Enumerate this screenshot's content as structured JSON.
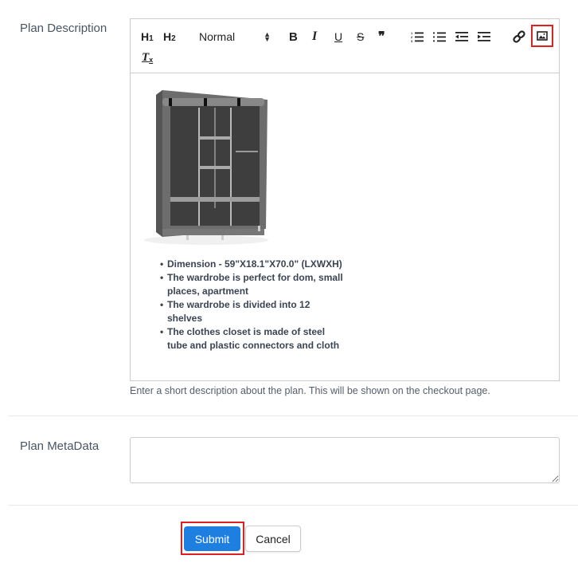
{
  "plan_description": {
    "label": "Plan Description",
    "toolbar": {
      "h1": "H",
      "h1_sub": "1",
      "h2": "H",
      "h2_sub": "2",
      "format_selected": "Normal",
      "bold": "B",
      "italic": "I",
      "underline": "U",
      "strike": "S",
      "quote": "❞",
      "clean": "T",
      "clean_sub": "x"
    },
    "content": {
      "image_alt": "Grey fabric wardrobe closet with shelves",
      "bullets": [
        "Dimension - 59\"X18.1\"X70.0\" (LXWXH)",
        "The wardrobe is perfect for dom, small places, apartment",
        "The wardrobe is divided into 12 shelves",
        "The clothes closet is made of steel tube and plastic connectors and cloth"
      ]
    },
    "help_text": "Enter a short description about the plan. This will be shown on the checkout page."
  },
  "plan_metadata": {
    "label": "Plan MetaData",
    "value": ""
  },
  "actions": {
    "submit": "Submit",
    "cancel": "Cancel"
  },
  "colors": {
    "primary": "#1e7fe0",
    "highlight": "#e02020"
  }
}
